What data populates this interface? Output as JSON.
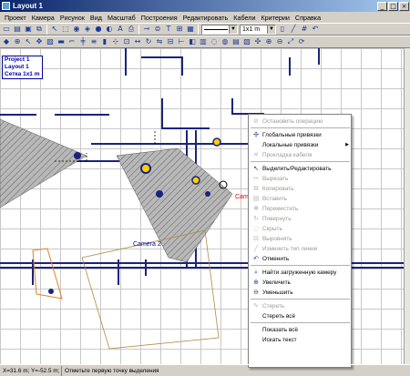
{
  "window": {
    "title": "Layout 1",
    "minimize": "_",
    "maximize": "□",
    "close": "×"
  },
  "menu": [
    "Проект",
    "Камера",
    "Рисунок",
    "Вид",
    "Масштаб",
    "Построения",
    "Редактировать",
    "Кабели",
    "Критерии",
    "Справка"
  ],
  "toolbar": {
    "row1_icons": [
      "new-icon",
      "open-icon",
      "save-icon",
      "copy-icon",
      "select-icon",
      "copy-area-icon",
      "camera-icon",
      "camera2-icon",
      "camera3-icon",
      "lens-icon",
      "text-icon",
      "print-icon",
      "cable-icon",
      "dome-icon",
      "t-icon",
      "node-icon",
      "box-icon",
      "line-icon",
      "rect-icon",
      "circle-icon",
      "fill-icon"
    ],
    "line_combo": "",
    "scale_combo": "1x1 m",
    "row2_icons": [
      "pointer-icon",
      "zoom-icon",
      "arrow-icon",
      "move-icon",
      "hatch-icon",
      "wall-icon",
      "door-icon",
      "window-icon",
      "stair-icon",
      "column-icon",
      "snap-icon",
      "grid-icon",
      "measure-icon",
      "rotate-icon",
      "mirror-icon",
      "align-icon",
      "dim-icon",
      "layer-icon",
      "lock-icon",
      "hide-icon",
      "show-icon",
      "group-icon",
      "ungroup-icon",
      "pan-icon",
      "zoom-in-icon",
      "zoom-out-icon",
      "fit-icon",
      "refresh-icon"
    ]
  },
  "canvas": {
    "info": [
      "Project 1",
      "Layout 1",
      "Сетка 1x1 m"
    ],
    "cameras": [
      "Camera 2",
      "Camera"
    ]
  },
  "context_menu": [
    {
      "label": "Остановить операцию",
      "icon": "stop-icon",
      "enabled": false
    },
    {
      "separator": true
    },
    {
      "label": "Глобальные привязки",
      "icon": "snap-icon",
      "enabled": true
    },
    {
      "label": "Локальные привязки",
      "icon": "",
      "enabled": true,
      "submenu": true
    },
    {
      "label": "Прокладка кабеля",
      "icon": "cable-icon",
      "enabled": false
    },
    {
      "separator": true
    },
    {
      "label": "Выделить/Редактировать",
      "icon": "select-icon",
      "enabled": true
    },
    {
      "label": "Вырезать",
      "icon": "cut-icon",
      "enabled": false
    },
    {
      "label": "Копировать",
      "icon": "copy-icon",
      "enabled": false
    },
    {
      "label": "Вставить",
      "icon": "paste-icon",
      "enabled": false
    },
    {
      "label": "Переместить",
      "icon": "move-icon",
      "enabled": false
    },
    {
      "label": "Повернуть",
      "icon": "rotate-icon",
      "enabled": false
    },
    {
      "label": "Скрыть",
      "icon": "hide-icon",
      "enabled": false
    },
    {
      "label": "Выровнять",
      "icon": "align-icon",
      "enabled": false
    },
    {
      "label": "Изменить тип линии",
      "icon": "linetype-icon",
      "enabled": false
    },
    {
      "label": "Отменить",
      "icon": "undo-icon",
      "enabled": true
    },
    {
      "separator": true
    },
    {
      "label": "Найти загруженную камеру",
      "icon": "find-camera-icon",
      "enabled": true
    },
    {
      "label": "Увеличить",
      "icon": "zoom-in-icon",
      "enabled": true
    },
    {
      "label": "Уменьшить",
      "icon": "zoom-out-icon",
      "enabled": true
    },
    {
      "separator": true
    },
    {
      "label": "Стереть",
      "icon": "erase-icon",
      "enabled": false
    },
    {
      "label": "Стереть всё",
      "icon": "",
      "enabled": true
    },
    {
      "separator": true
    },
    {
      "label": "Показать всё",
      "icon": "",
      "enabled": true
    },
    {
      "label": "Искать текст",
      "icon": "",
      "enabled": true
    }
  ],
  "status": {
    "coords": "X=31.6 m; Y=-52.5 m;",
    "hint": "Отметьте первую точку выделения"
  }
}
